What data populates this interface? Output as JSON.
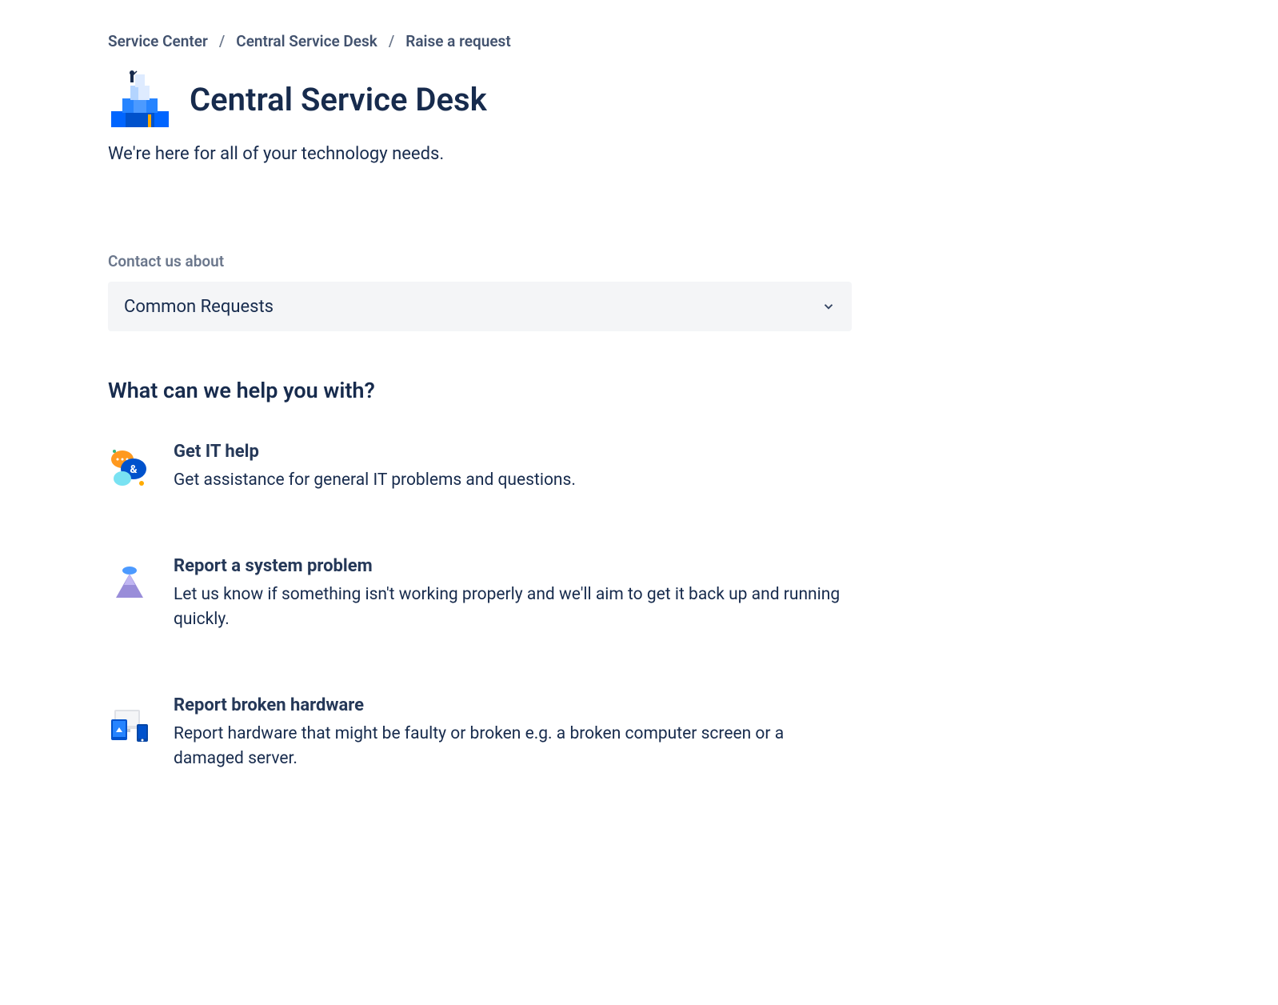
{
  "breadcrumb": {
    "items": [
      "Service Center",
      "Central Service Desk",
      "Raise a request"
    ]
  },
  "header": {
    "title": "Central Service Desk",
    "subtitle": "We're here for all of your technology needs."
  },
  "contact": {
    "label": "Contact us about",
    "selected": "Common Requests"
  },
  "help": {
    "heading": "What can we help you with?",
    "requests": [
      {
        "title": "Get IT help",
        "description": "Get assistance for general IT problems and questions."
      },
      {
        "title": "Report a system problem",
        "description": "Let us know if something isn't working properly and we'll aim to get it back up and running quickly."
      },
      {
        "title": "Report broken hardware",
        "description": "Report hardware that might be faulty or broken e.g. a broken computer screen or a damaged server."
      }
    ]
  }
}
